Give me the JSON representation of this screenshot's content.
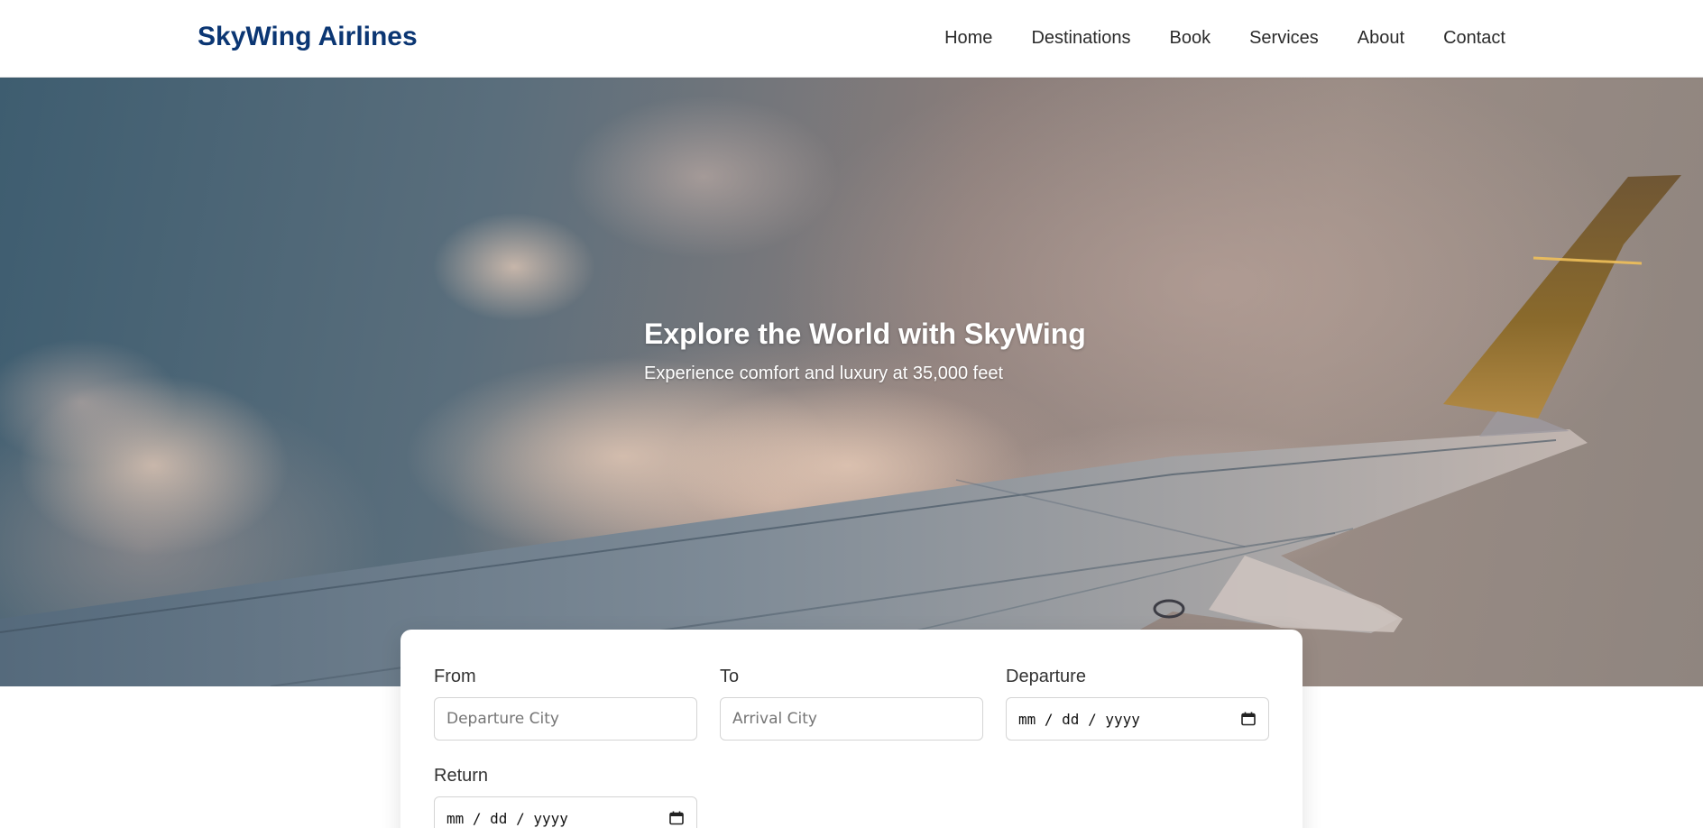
{
  "header": {
    "logo": "SkyWing Airlines",
    "nav": [
      "Home",
      "Destinations",
      "Book",
      "Services",
      "About",
      "Contact"
    ]
  },
  "hero": {
    "title": "Explore the World with SkyWing",
    "subtitle": "Experience comfort and luxury at 35,000 feet"
  },
  "booking": {
    "from": {
      "label": "From",
      "placeholder": "Departure City"
    },
    "to": {
      "label": "To",
      "placeholder": "Arrival City"
    },
    "departure": {
      "label": "Departure",
      "value": "mm / dd / yyyy",
      "icon": "calendar-icon"
    },
    "return": {
      "label": "Return",
      "value": "mm / dd / yyyy",
      "icon": "calendar-icon"
    }
  },
  "colors": {
    "brand": "#0b3673",
    "nav_text": "#2b2b2b"
  }
}
